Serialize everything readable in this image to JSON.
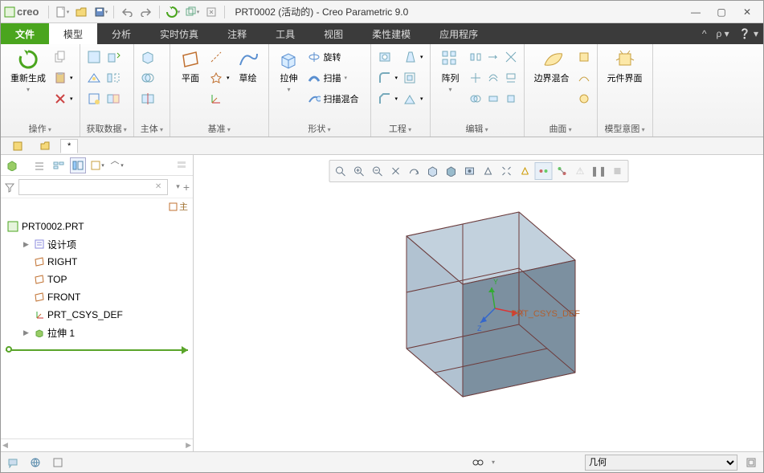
{
  "brand": "creo",
  "title": "PRT0002 (活动的) - Creo Parametric 9.0",
  "tabs": {
    "file": "文件",
    "items": [
      "模型",
      "分析",
      "实时仿真",
      "注释",
      "工具",
      "视图",
      "柔性建模",
      "应用程序"
    ],
    "active_index": 0
  },
  "ribbon": {
    "groups": [
      {
        "id": "ops",
        "label": "操作",
        "big": {
          "label": "重新生成"
        }
      },
      {
        "id": "getdata",
        "label": "获取数据"
      },
      {
        "id": "body",
        "label": "主体"
      },
      {
        "id": "datum",
        "label": "基准",
        "btns": [
          {
            "label": "平面"
          },
          {
            "label": "草绘"
          }
        ]
      },
      {
        "id": "shape",
        "label": "形状",
        "big": {
          "label": "拉伸"
        },
        "lines": [
          "旋转",
          "扫描",
          "扫描混合"
        ]
      },
      {
        "id": "eng",
        "label": "工程"
      },
      {
        "id": "edit",
        "label": "编辑",
        "big": {
          "label": "阵列"
        }
      },
      {
        "id": "surf",
        "label": "曲面",
        "big": {
          "label": "边界混合"
        }
      },
      {
        "id": "intent",
        "label": "模型意图",
        "big": {
          "label": "元件界面"
        }
      }
    ]
  },
  "subtabs": [
    "",
    "",
    "*"
  ],
  "tree": {
    "root": "PRT0002.PRT",
    "annot_hdr": "主",
    "children": [
      {
        "label": "设计项",
        "icon": "list",
        "expandable": true
      },
      {
        "label": "RIGHT",
        "icon": "plane"
      },
      {
        "label": "TOP",
        "icon": "plane"
      },
      {
        "label": "FRONT",
        "icon": "plane"
      },
      {
        "label": "PRT_CSYS_DEF",
        "icon": "csys"
      },
      {
        "label": "拉伸 1",
        "icon": "extrude",
        "expandable": true
      }
    ]
  },
  "csys_label": "PRT_CSYS_DEF",
  "status": {
    "filter_label": "几何",
    "filter_options": [
      "几何"
    ]
  },
  "colors": {
    "accent_green": "#4aa51e",
    "accent_blue": "#5a8fd0",
    "cube_fill": "#9bb3c7",
    "cube_edge": "#6d3a3a"
  }
}
